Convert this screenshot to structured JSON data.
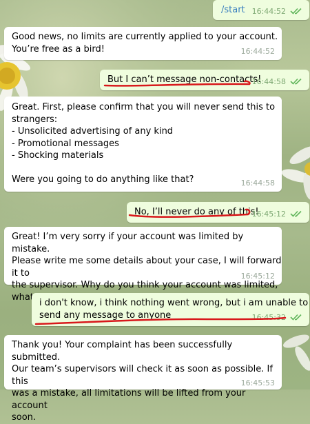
{
  "messages": [
    {
      "id": "m1",
      "dir": "out",
      "text": "/start",
      "time": "16:44:52",
      "link": true
    },
    {
      "id": "m2",
      "dir": "in",
      "text": "Good news, no limits are currently applied to your account.\nYou’re free as a bird!",
      "time": "16:44:52"
    },
    {
      "id": "m3",
      "dir": "out",
      "text": "But I can’t message non-contacts!",
      "time": "16:44:58"
    },
    {
      "id": "m4",
      "dir": "in",
      "text": "Great. First, please confirm that you will never send this to\nstrangers:\n- Unsolicited advertising of any kind\n- Promotional messages\n- Shocking materials\n\nWere you going to do anything like that?",
      "time": "16:44:58"
    },
    {
      "id": "m5",
      "dir": "out",
      "text": "No, I’ll never do any of this!",
      "time": "16:45:12"
    },
    {
      "id": "m6",
      "dir": "in",
      "text": "Great! I’m very sorry if your account was limited by mistake.\nPlease write me some details about your case, I will forward it to\nthe supervisor. Why do you think your account was limited,\nwhat went wrong?",
      "time": "16:45:12"
    },
    {
      "id": "m7",
      "dir": "out",
      "text": "i don't know, i think nothing went wrong, but i am unable to\nsend any message to anyone",
      "time": "16:45:32"
    },
    {
      "id": "m8",
      "dir": "in",
      "text": "Thank you! Your complaint has been successfully submitted.\nOur team’s supervisors will check it as soon as possible. If this\nwas a mistake, all limitations will be lifted from your account\nsoon.",
      "time": "16:45:53"
    }
  ],
  "colors": {
    "incoming_bubble": "#ffffff",
    "outgoing_bubble": "#effdde",
    "link": "#3a7fbf",
    "read_check": "#5fb55a",
    "annotation_red": "#d8181b"
  }
}
